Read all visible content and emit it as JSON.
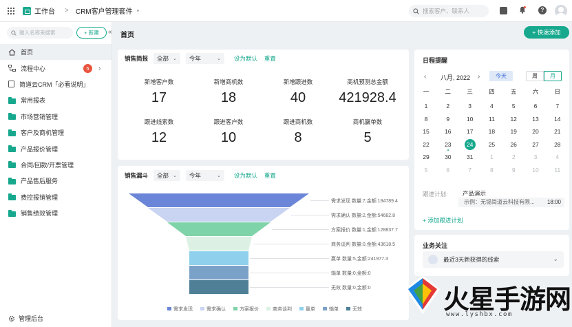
{
  "topbar": {
    "workspace": "工作台",
    "separator": ">",
    "app_name": "CRM客户管理套件",
    "caret": "▾",
    "search_placeholder": "搜索客户、联系人",
    "help_glyph": "?"
  },
  "sidebar": {
    "search_placeholder": "输入名称来搜索",
    "new_label": "+ 新建",
    "collapse_glyph": "«",
    "items": [
      {
        "label": "首页",
        "icon": "home-icon",
        "active": true
      },
      {
        "label": "流程中心",
        "icon": "flow-icon",
        "badge": "5",
        "chevron": "›"
      },
      {
        "label": "简道云CRM「必看说明」",
        "icon": "doc-icon"
      },
      {
        "label": "常用报表",
        "icon": "folder-icon"
      },
      {
        "label": "市场营销管理",
        "icon": "folder-icon"
      },
      {
        "label": "客户及商机管理",
        "icon": "folder-icon"
      },
      {
        "label": "产品报价管理",
        "icon": "folder-icon"
      },
      {
        "label": "合同/回款/开票管理",
        "icon": "folder-icon"
      },
      {
        "label": "产品售后服务",
        "icon": "folder-icon"
      },
      {
        "label": "费控报销管理",
        "icon": "folder-icon"
      },
      {
        "label": "销售绩效管理",
        "icon": "folder-icon"
      }
    ],
    "bottom_label": "管理后台"
  },
  "main": {
    "page_title": "首页",
    "quick_add": "+ 快速添加"
  },
  "briefing": {
    "title": "销售简报",
    "filter_scope": "全部",
    "filter_period": "今年",
    "set_default": "设为默认",
    "reset": "重置",
    "kpis": [
      {
        "label": "新增客户数",
        "value": "17"
      },
      {
        "label": "新增商机数",
        "value": "18"
      },
      {
        "label": "新增跟进数",
        "value": "40"
      },
      {
        "label": "商机预测总金额",
        "value": "421928.4"
      },
      {
        "label": "跟进线索数",
        "value": "12"
      },
      {
        "label": "跟进客户数",
        "value": "10"
      },
      {
        "label": "跟进商机数",
        "value": "8"
      },
      {
        "label": "商机赢单数",
        "value": "5"
      }
    ]
  },
  "funnel": {
    "title": "销售漏斗",
    "filter_scope": "全部",
    "filter_period": "今年",
    "set_default": "设为默认",
    "reset": "重置",
    "stages": [
      {
        "name": "需求发现",
        "label": "需求发现 数量:7,金额:184789.4",
        "color": "#6b86d8"
      },
      {
        "name": "需求确认",
        "label": "需求确认 数量:2,金额:54682.8",
        "color": "#c9d3f2"
      },
      {
        "name": "方案报价",
        "label": "方案报价 数量:1,金额:128837.7",
        "color": "#7fd3a8"
      },
      {
        "name": "商务谈判",
        "label": "商务谈判 数量:0,金额:43618.5",
        "color": "#dcf1e4"
      },
      {
        "name": "赢单",
        "label": "赢单 数量:5,金额:241977.3",
        "color": "#8fd0ec"
      },
      {
        "name": "输单",
        "label": "输单 数量:0,金额:0",
        "color": "#7aa2c8"
      },
      {
        "name": "无效",
        "label": "无效 数量:0,金额:0",
        "color": "#4f7f97"
      }
    ]
  },
  "calendar": {
    "title": "日程提醒",
    "prev": "‹",
    "next": "›",
    "month": "八月, 2022",
    "today_btn": "今天",
    "view_week": "周",
    "view_month": "月",
    "weekdays": [
      "一",
      "二",
      "三",
      "四",
      "五",
      "六",
      "日"
    ],
    "weeks": [
      [
        [
          "1",
          0
        ],
        [
          "2",
          0
        ],
        [
          "3",
          0
        ],
        [
          "4",
          0
        ],
        [
          "5",
          0
        ],
        [
          "6",
          0
        ],
        [
          "7",
          0
        ]
      ],
      [
        [
          "8",
          0
        ],
        [
          "9",
          0
        ],
        [
          "10",
          0
        ],
        [
          "11",
          0
        ],
        [
          "12",
          0
        ],
        [
          "13",
          0
        ],
        [
          "14",
          0
        ]
      ],
      [
        [
          "15",
          0
        ],
        [
          "16",
          0
        ],
        [
          "17",
          0
        ],
        [
          "18",
          0
        ],
        [
          "19",
          0
        ],
        [
          "20",
          0
        ],
        [
          "21",
          0
        ]
      ],
      [
        [
          "22",
          0
        ],
        [
          "23",
          0
        ],
        [
          "24",
          0
        ],
        [
          "25",
          0
        ],
        [
          "26",
          0
        ],
        [
          "27",
          0
        ],
        [
          "28",
          0
        ]
      ],
      [
        [
          "29",
          0
        ],
        [
          "30",
          0
        ],
        [
          "31",
          0
        ],
        [
          "1",
          1
        ],
        [
          "2",
          1
        ],
        [
          "3",
          1
        ],
        [
          "4",
          1
        ]
      ],
      [
        [
          "5",
          1
        ],
        [
          "6",
          1
        ],
        [
          "7",
          1
        ],
        [
          "8",
          1
        ],
        [
          "9",
          1
        ],
        [
          "10",
          1
        ],
        [
          "11",
          1
        ]
      ]
    ],
    "today": "24",
    "plan_label": "跟进计划:",
    "plan_title": "产品演示",
    "plan_sub": "示例：无锡简道云科技有限...",
    "plan_time": "18:00",
    "add_plan": "+ 添加跟进计划"
  },
  "biz_focus": {
    "title": "业务关注",
    "row_label": "最近3天新获得的线索",
    "chevron": "⌄"
  },
  "watermark": {
    "text": "火星手游网",
    "url": "www.lyshbx.com"
  }
}
